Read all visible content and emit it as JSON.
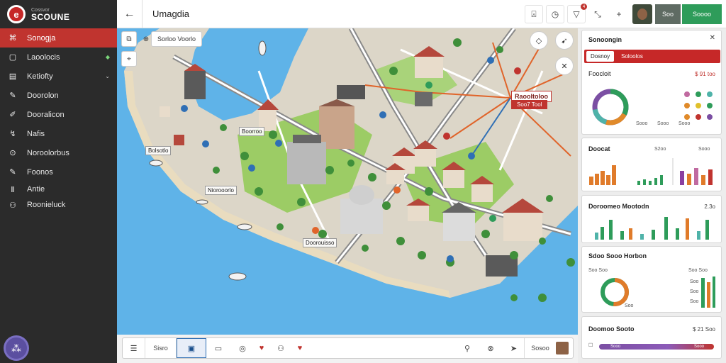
{
  "sidebar": {
    "brand_small": "Cossvor",
    "brand_name": "SCOUNE",
    "items": [
      {
        "label": "Sonogja",
        "icon": "map-icon",
        "active": true
      },
      {
        "label": "Laoolocis",
        "icon": "layers-icon"
      },
      {
        "label": "Ketiofty",
        "icon": "list-icon"
      },
      {
        "label": "Doorolon",
        "icon": "pen-icon"
      },
      {
        "label": "Dooralicon",
        "icon": "edit-icon"
      },
      {
        "label": "Nafis",
        "icon": "route-icon"
      },
      {
        "label": "Noroolorbus",
        "icon": "pin-icon"
      },
      {
        "label": "Foonos",
        "icon": "pencil-icon"
      },
      {
        "label": "Antie",
        "icon": "bars-icon"
      },
      {
        "label": "Roonieluck",
        "icon": "people-icon"
      }
    ]
  },
  "topbar": {
    "title": "Umagdia",
    "badge": "4",
    "grey_label": "Soo",
    "green_label": "Soooo"
  },
  "map": {
    "search_text": "Sorloo Voorlo",
    "labels": [
      "Bolsotlo",
      "Niorooorlo",
      "Boorroo",
      "Doorouisso"
    ],
    "callout_title": "Raooltoloo",
    "callout_value": "Soo7 Tool"
  },
  "bottombar": {
    "items": [
      "Sisro",
      "Sosoo"
    ]
  },
  "panel": {
    "header": {
      "title": "Sonoongin",
      "tab1": "Dosnoy",
      "tab2": "Soloolos"
    },
    "card1": {
      "title": "Foocloit",
      "value": "$ 91 too",
      "legend": [
        "Sooo",
        "Sooo",
        "Sooo"
      ]
    },
    "card2": {
      "title": "Doocat",
      "v1": "S2oo",
      "v2": "Sooo"
    },
    "card3": {
      "title": "Doroomeo Mootodn",
      "value": "2.3o"
    },
    "card4": {
      "title": "Sdoo Sooo Horbon",
      "left": "Soo Soo",
      "right": "Soo Soo",
      "mini": [
        "Soo",
        "Soo",
        "Soo"
      ],
      "center": "Soo"
    },
    "card5": {
      "title": "Doomoo Sooto",
      "value": "$ 21 Soo",
      "bar_left": "Sooo",
      "bar_right": "Sooo"
    }
  },
  "colors": {
    "accent": "#c0342f",
    "sidebar": "#2b2b2b",
    "green": "#2e9c5a",
    "water": "#5fb3e8",
    "land": "#dcd6c8",
    "park": "#9ccc65"
  }
}
